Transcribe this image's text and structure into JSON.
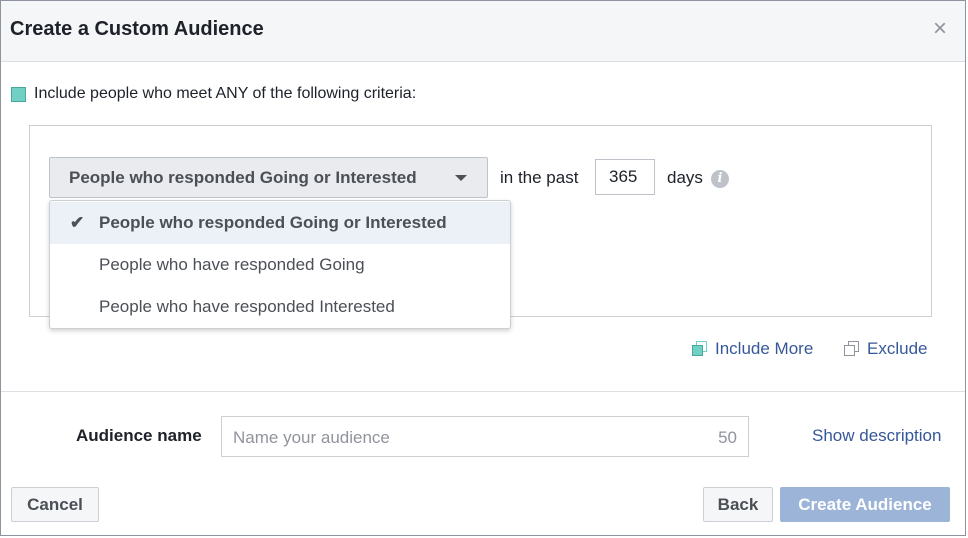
{
  "dialog": {
    "title": "Create a Custom Audience",
    "close_glyph": "×"
  },
  "criteria": {
    "text": "Include people who meet ANY of the following criteria:"
  },
  "rule": {
    "selected_event": "People who responded Going or Interested",
    "in_the_past_label": "in the past",
    "days_value": "365",
    "days_label": "days",
    "dropdown_options": [
      {
        "label": "People who responded Going or Interested",
        "selected": true
      },
      {
        "label": "People who have responded Going",
        "selected": false
      },
      {
        "label": "People who have responded Interested",
        "selected": false
      }
    ]
  },
  "links": {
    "include_more": "Include More",
    "exclude": "Exclude"
  },
  "audience": {
    "label": "Audience name",
    "placeholder": "Name your audience",
    "char_limit": "50",
    "show_description": "Show description"
  },
  "footer": {
    "cancel": "Cancel",
    "back": "Back",
    "create": "Create Audience"
  },
  "colors": {
    "accent_teal": "#6fd0c3",
    "link_blue": "#365899",
    "disabled_primary": "#9cb4d8"
  }
}
